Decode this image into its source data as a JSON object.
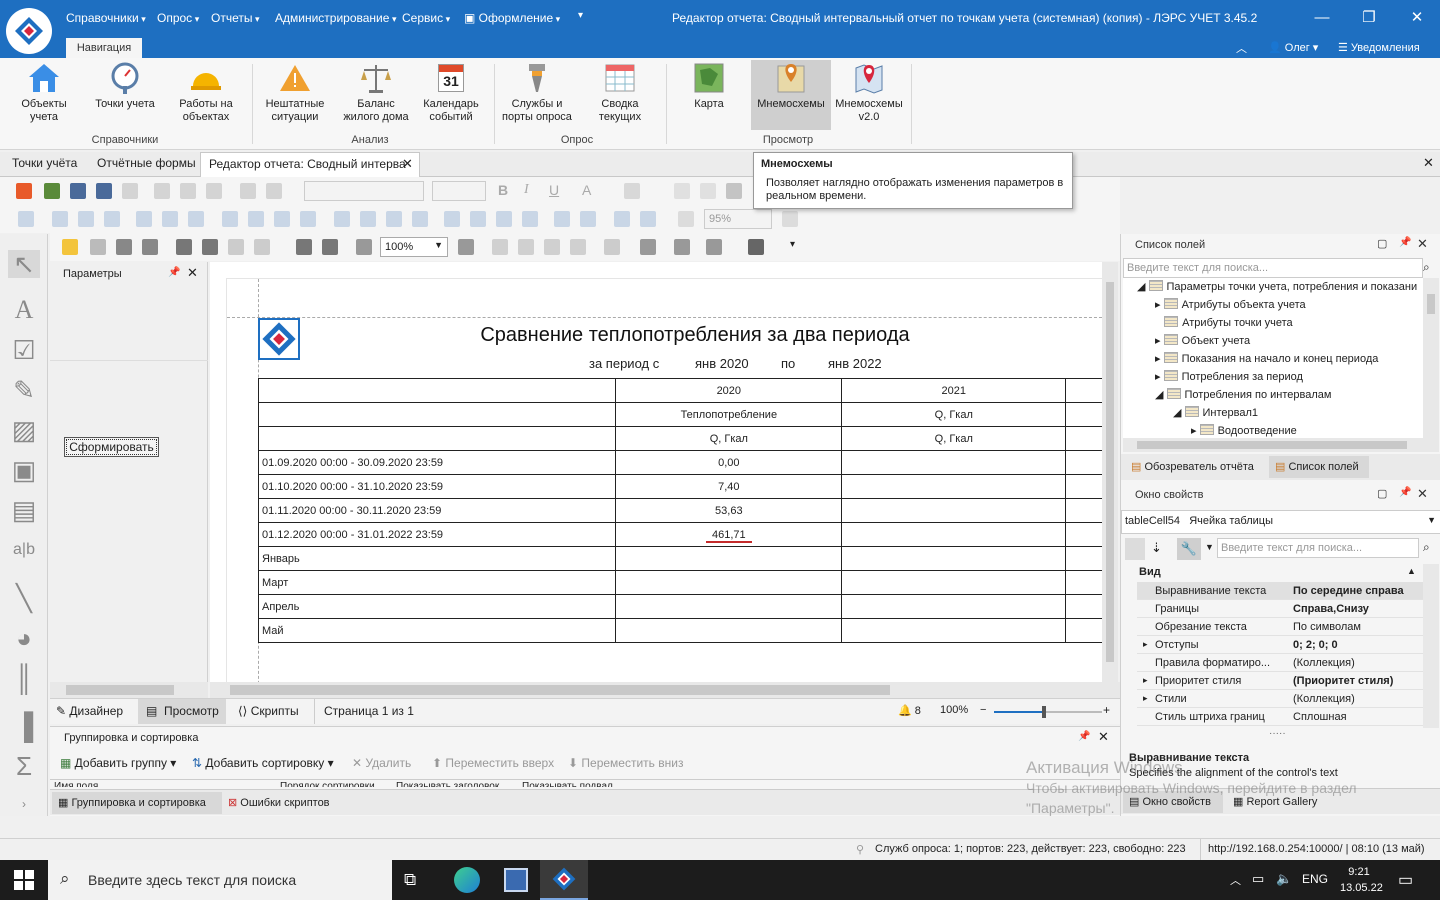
{
  "window": {
    "title": "Редактор отчета: Сводный интервальный отчет по точкам учета (системная) (копия) - ЛЭРС УЧЕТ 3.45.2",
    "minimize": "—",
    "maximize": "❐",
    "close": "✕"
  },
  "menu": [
    "Справочники",
    "Опрос",
    "Отчеты",
    "Администрирование",
    "Сервис",
    "Оформление"
  ],
  "nav_tab": "Навигация",
  "user": "Олег",
  "notifications": "Уведомления",
  "ribbon": {
    "buttons": [
      "Объекты учета",
      "Точки учета",
      "Работы на объектах",
      "Нештатные ситуации",
      "Баланс жилого дома",
      "Календарь событий",
      "Службы и порты опроса",
      "Сводка текущих",
      "Карта",
      "Мнемосхемы",
      "Мнемосхемы v2.0"
    ],
    "calendar_day": "31",
    "groups": [
      "Справочники",
      "Анализ",
      "Опрос",
      "Просмотр"
    ]
  },
  "doc_tabs": [
    "Точки учёта",
    "Отчётные формы",
    "Редактор отчета: Сводный интерва"
  ],
  "tooltip": {
    "title": "Мнемосхемы",
    "text": "Позволяет наглядно отображать изменения параметров в реальном времени."
  },
  "toolbar": {
    "zoom_disabled": "95%",
    "zoom": "100%"
  },
  "params": {
    "title": "Параметры",
    "button": "Сформировать"
  },
  "report": {
    "title": "Сравнение теплопотребления за два периода",
    "period_label": "за период с",
    "from": "янв 2020",
    "to_label": "по",
    "to": "янв 2022",
    "headers": [
      "2020",
      "2021"
    ],
    "sub1": [
      "Теплопотребление",
      "Q, Гкал"
    ],
    "sub2": [
      "Q, Гкал",
      "Q, Гкал"
    ],
    "rows": [
      [
        "01.09.2020 00:00 - 30.09.2020 23:59",
        "0,00",
        ""
      ],
      [
        "01.10.2020 00:00 - 31.10.2020 23:59",
        "7,40",
        ""
      ],
      [
        "01.11.2020 00:00 - 30.11.2020 23:59",
        "53,63",
        ""
      ],
      [
        "01.12.2020 00:00 - 31.01.2022 23:59",
        "461,71",
        ""
      ],
      [
        "Январь",
        "",
        ""
      ],
      [
        "Март",
        "",
        ""
      ],
      [
        "Апрель",
        "",
        ""
      ],
      [
        "Май",
        "",
        ""
      ]
    ]
  },
  "report_status": {
    "design": "Дизайнер",
    "preview": "Просмотр",
    "scripts": "Скрипты",
    "page": "Страница 1 из 1",
    "notif_count": "8",
    "zoom": "100%"
  },
  "grouping": {
    "title": "Группировка и сортировка",
    "add_group": "Добавить группу",
    "add_sort": "Добавить сортировку",
    "delete": "Удалить",
    "move_up": "Переместить вверх",
    "move_down": "Переместить вниз",
    "cols": [
      "Имя поля",
      "Порядок сортировки",
      "Показывать заголовок",
      "Показывать подвал"
    ],
    "tab1": "Группировка и сортировка",
    "tab2": "Ошибки скриптов"
  },
  "fields": {
    "title": "Список полей",
    "search": "Введите текст для поиска...",
    "tree": [
      "Параметры точки учета, потребления и показани",
      "Атрибуты объекта учета",
      "Атрибуты точки учета",
      "Объект учета",
      "Показания на начало и конец периода",
      "Потребления за период",
      "Потребления по интервалам",
      "Интервал1",
      "Водоотведение"
    ],
    "tab1": "Обозреватель отчёта",
    "tab2": "Список полей"
  },
  "props": {
    "title": "Окно свойств",
    "selected": "tableCell54",
    "selected_type": "Ячейка таблицы",
    "search": "Введите текст для поиска...",
    "category": "Вид",
    "rows": [
      [
        "Выравнивание текста",
        "По середине справа"
      ],
      [
        "Границы",
        "Справа,Снизу"
      ],
      [
        "Обрезание текста",
        "По символам"
      ],
      [
        "Отступы",
        "0; 2; 0; 0"
      ],
      [
        "Правила форматиро...",
        "(Коллекция)"
      ],
      [
        "Приоритет стиля",
        "(Приоритет стиля)"
      ],
      [
        "Стили",
        "(Коллекция)"
      ],
      [
        "Стиль штриха границ",
        "Сплошная"
      ]
    ],
    "desc_title": "Выравнивание текста",
    "desc": "Specifies the alignment of the control's text",
    "tab1": "Окно свойств",
    "tab2": "Report Gallery"
  },
  "status": {
    "services": "Служб опроса: 1; портов: 223, действует: 223, свободно: 223",
    "url": "http://192.168.0.254:10000/ | 08:10 (13 май)"
  },
  "watermark": {
    "l1": "Активация Windows",
    "l2": "Чтобы активировать Windows, перейдите в раздел",
    "l3": "\"Параметры\"."
  },
  "taskbar": {
    "search": "Введите здесь текст для поиска",
    "lang": "ENG",
    "time": "9:21",
    "date": "13.05.22"
  }
}
